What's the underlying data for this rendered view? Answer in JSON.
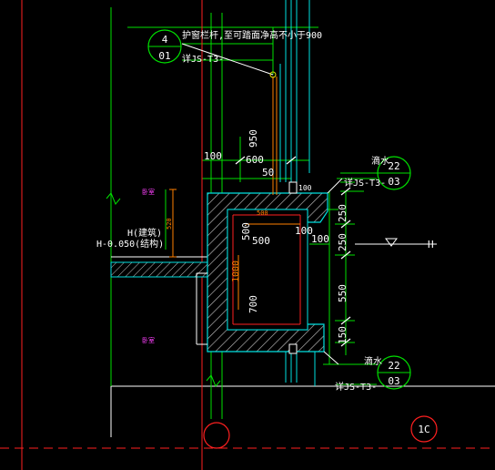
{
  "colors": {
    "background": "#000000",
    "axis_green": "#00e000",
    "wall_cyan": "#00e0e0",
    "white": "#ffffff",
    "red": "#ff2020",
    "orange": "#ff8000",
    "magenta": "#ff40ff",
    "yellow": "#e0e000",
    "blue": "#2020ff",
    "gray": "#9a9a9a"
  },
  "callout_top": {
    "num_top": "4",
    "num_bottom": "01",
    "note": "护窗栏杆,至可踏面净高不小于900",
    "ref": "详JS-T3-"
  },
  "callout_right_top": {
    "label": "滴水",
    "num_top": "22",
    "num_bottom": "03",
    "ref": "详JS-T3-"
  },
  "callout_right_bottom": {
    "label": "滴水",
    "num_top": "22",
    "num_bottom": "03",
    "ref": "详JS-T3-"
  },
  "dims": {
    "d950": "950",
    "d100_top": "100",
    "d600": "600",
    "d50": "50",
    "d100_right": "100",
    "d100_inner": "100",
    "d500_a": "500",
    "d500_b": "500",
    "d500_small": "500",
    "d700": "700",
    "d1000": "1000",
    "d520": "520",
    "d250_a": "250",
    "d250_b": "250",
    "d550": "550",
    "d150": "150"
  },
  "levels": {
    "h_building": "H(建筑)",
    "h_structure": "H-0.050(结构)",
    "h_right": "H"
  },
  "rooms": {
    "room_upper": "卧室",
    "room_lower": "卧室"
  },
  "grid": {
    "bubble_right": "1C"
  }
}
